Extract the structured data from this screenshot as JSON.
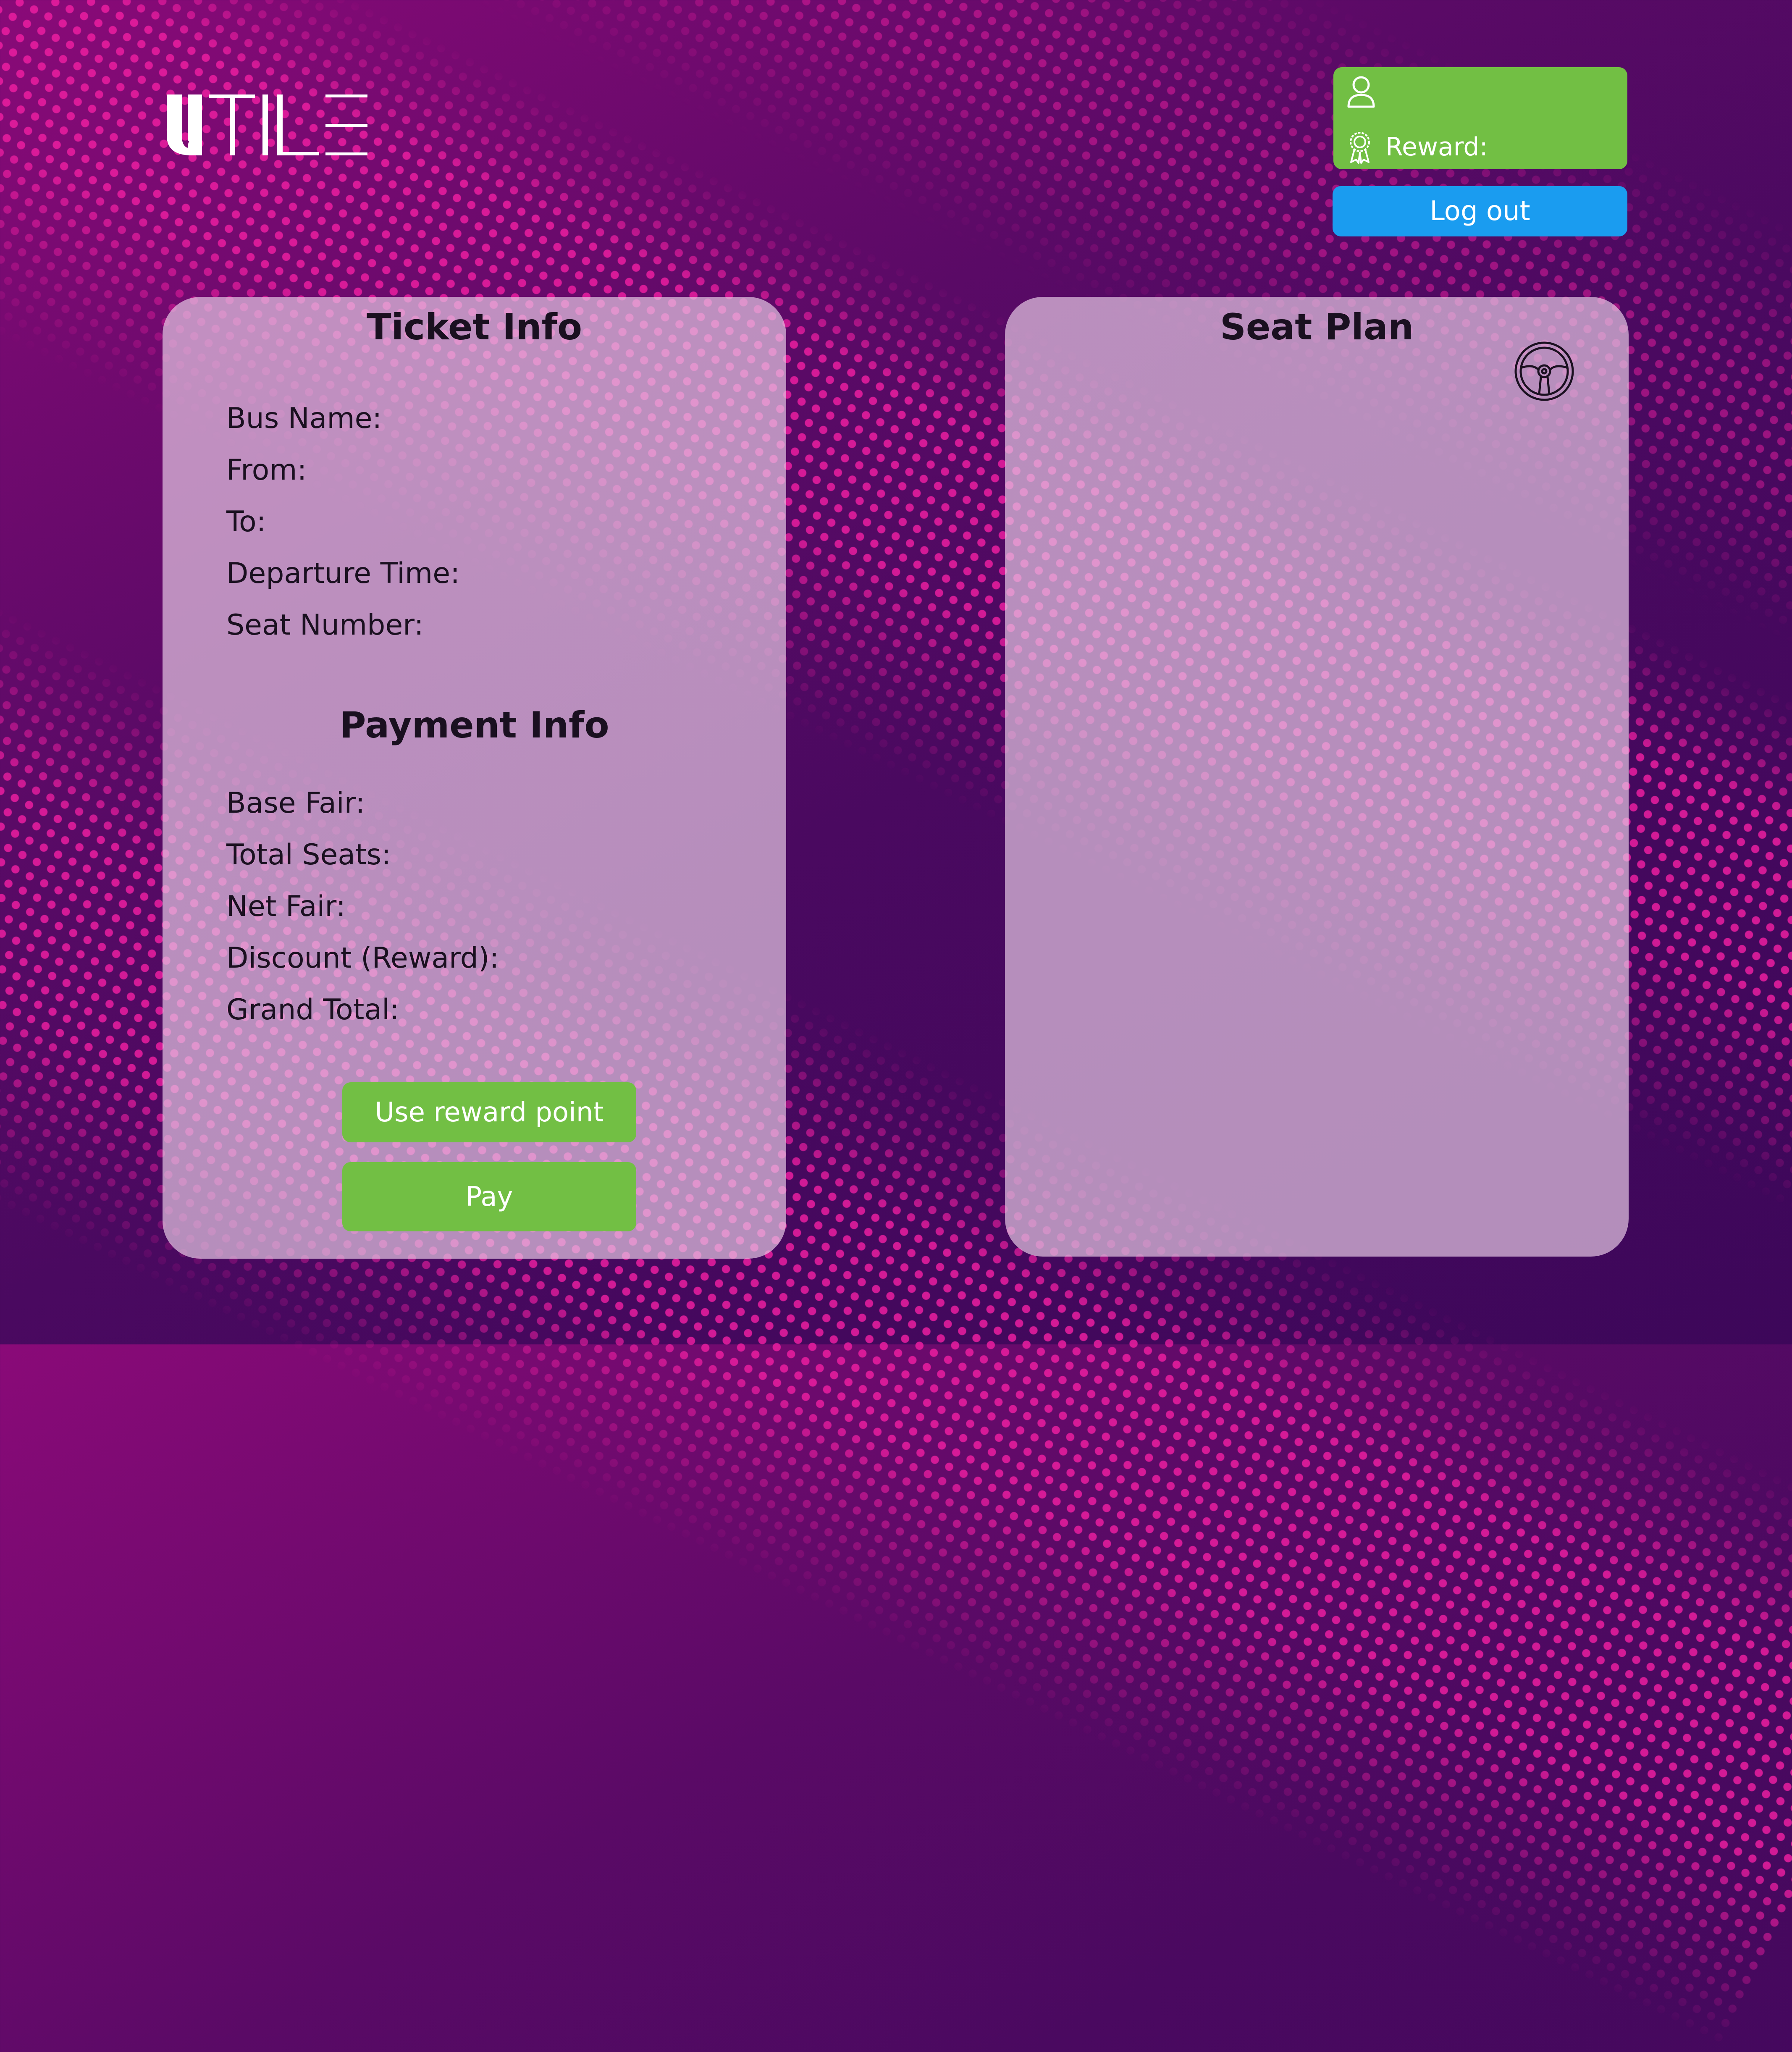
{
  "header": {
    "logo_text": "UTILE"
  },
  "user_panel": {
    "username": "",
    "reward_label": "Reward:",
    "logout_label": "Log out"
  },
  "ticket_info": {
    "title": "Ticket Info",
    "fields": [
      "Bus Name:",
      "From:",
      "To:",
      "Departure Time:",
      "Seat Number:"
    ]
  },
  "payment_info": {
    "title": "Payment Info",
    "fields": [
      "Base Fair:",
      "Total Seats:",
      "Net Fair:",
      "Discount (Reward):",
      "Grand Total:"
    ],
    "use_reward_label": "Use reward point",
    "pay_label": "Pay"
  },
  "seat_plan": {
    "title": "Seat Plan",
    "icon": "steering-wheel-icon"
  },
  "colors": {
    "accent_green": "#72bf44",
    "accent_blue": "#1a9cf0",
    "background_purple": "#4a0960",
    "dot_pink": "#eb1ea0"
  }
}
